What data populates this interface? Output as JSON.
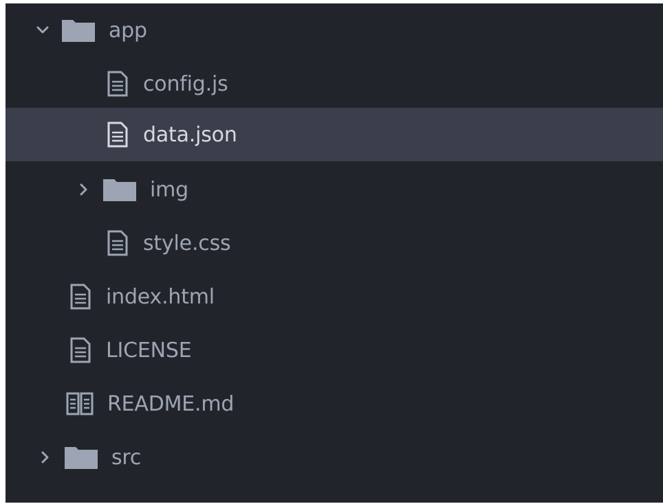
{
  "file_tree": {
    "items": [
      {
        "label": "app",
        "type": "folder",
        "expanded": true,
        "selected": false,
        "icon": "folder-icon"
      },
      {
        "label": "config.js",
        "type": "file",
        "selected": false,
        "icon": "file-text-icon"
      },
      {
        "label": "data.json",
        "type": "file",
        "selected": true,
        "icon": "file-text-icon"
      },
      {
        "label": "img",
        "type": "folder",
        "expanded": false,
        "selected": false,
        "icon": "folder-icon"
      },
      {
        "label": "style.css",
        "type": "file",
        "selected": false,
        "icon": "file-text-icon"
      },
      {
        "label": "index.html",
        "type": "file",
        "selected": false,
        "icon": "file-text-icon"
      },
      {
        "label": "LICENSE",
        "type": "file",
        "selected": false,
        "icon": "file-text-icon"
      },
      {
        "label": "README.md",
        "type": "file",
        "selected": false,
        "icon": "book-icon"
      },
      {
        "label": "src",
        "type": "folder",
        "expanded": false,
        "selected": false,
        "icon": "folder-icon"
      }
    ]
  },
  "colors": {
    "background": "#21252b",
    "selected_row": "#3a3f4b",
    "text": "#9da5b4",
    "selected_text": "#d7dae0",
    "icon": "#9da5b4"
  }
}
